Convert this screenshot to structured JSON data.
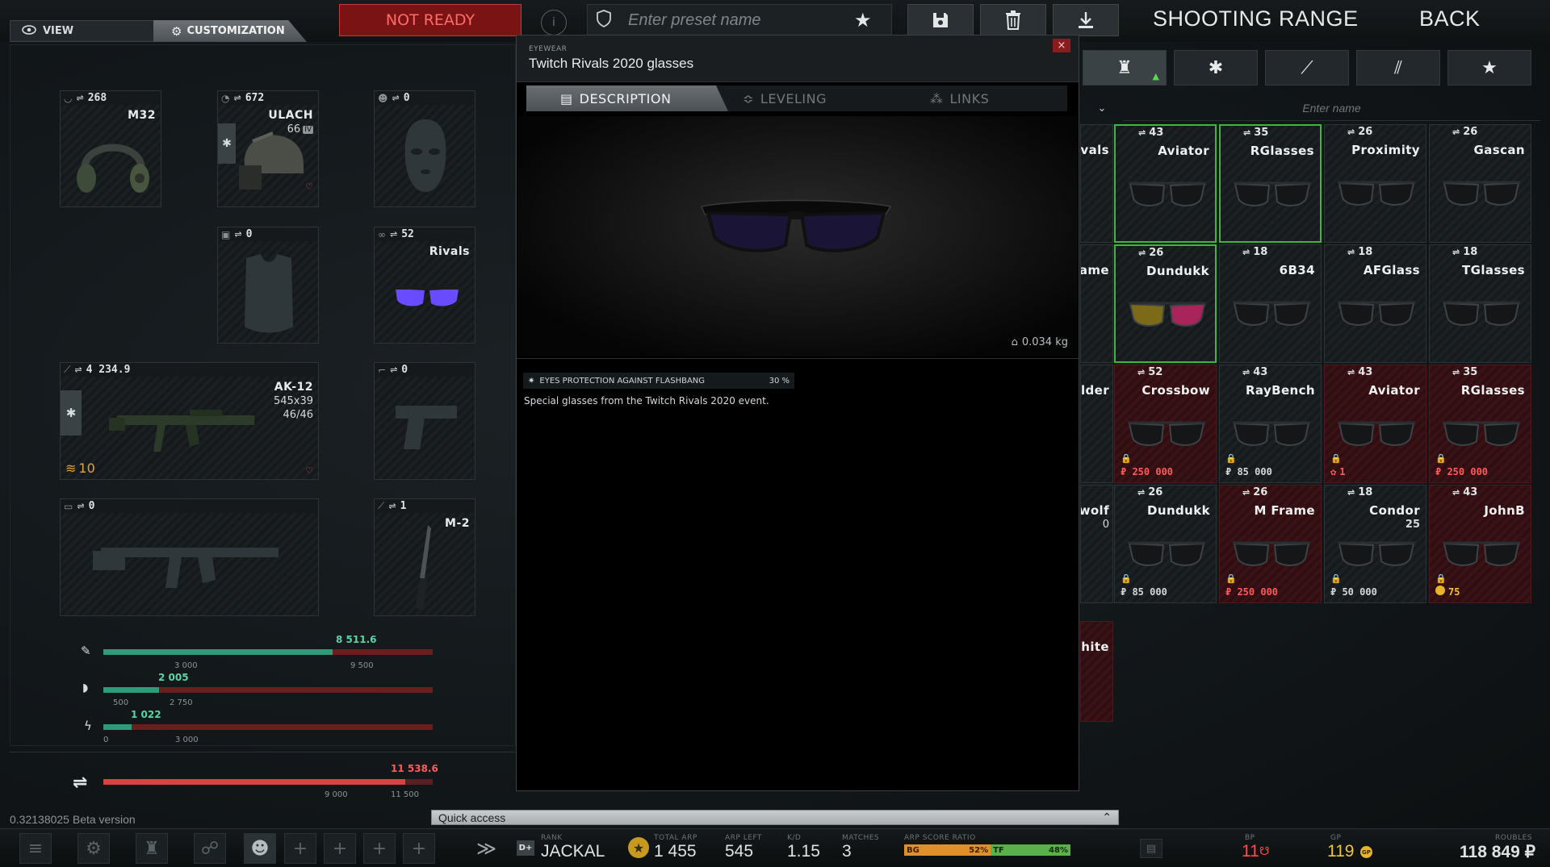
{
  "topbar": {
    "tab_view": "VIEW",
    "tab_customization": "CUSTOMIZATION",
    "not_ready": "NOT READY",
    "preset_placeholder": "Enter preset name",
    "shooting_range": "SHOOTING RANGE",
    "back": "BACK"
  },
  "loadout": {
    "headset": {
      "ap": "268",
      "name": "M32"
    },
    "helmet": {
      "ap": "672",
      "name": "ULACH",
      "durability": "66",
      "class": "IV"
    },
    "face": {
      "ap": "0"
    },
    "armor": {
      "ap": "0"
    },
    "eyewear": {
      "ap": "52",
      "name": "Rivals"
    },
    "primary": {
      "ap": "4 234.9",
      "name": "AK-12",
      "caliber": "545x39",
      "ammo": "46/46",
      "level": "10"
    },
    "holster": {
      "ap": "0"
    },
    "secondary": {
      "ap": "0"
    },
    "melee": {
      "ap": "1",
      "name": "M-2"
    }
  },
  "stats": [
    {
      "value": "8 511.6",
      "min": "3 000",
      "max": "9 500"
    },
    {
      "value": "2 005",
      "min": "500",
      "max": "2 750"
    },
    {
      "value": "1 022",
      "min": "0",
      "max": "3 000"
    }
  ],
  "total_ap": {
    "value": "11 538.6",
    "min": "9 000",
    "max": "11 500"
  },
  "version": "0.32138025 Beta version",
  "modal": {
    "category": "EYEWEAR",
    "title": "Twitch Rivals 2020 glasses",
    "tabs": [
      "DESCRIPTION",
      "LEVELING",
      "LINKS"
    ],
    "weight": "0.034 kg",
    "property_name": "EYES PROTECTION AGAINST FLASHBANG",
    "property_value": "30 %",
    "description": "Special glasses from the Twitch Rivals 2020 event."
  },
  "quick_access": "Quick access",
  "right": {
    "search_placeholder": "Enter name"
  },
  "cards_partial": [
    "vals",
    "ame",
    "lder",
    "wolf",
    "hite"
  ],
  "cards_partial_extra": "0",
  "cards": [
    {
      "ap": "43",
      "name": "Aviator",
      "style": "sel",
      "price": ""
    },
    {
      "ap": "35",
      "name": "RGlasses",
      "style": "sel",
      "price": ""
    },
    {
      "ap": "26",
      "name": "Proximity",
      "style": "",
      "price": ""
    },
    {
      "ap": "26",
      "name": "Gascan",
      "style": "",
      "price": ""
    },
    {
      "ap": "26",
      "name": "Dundukk",
      "style": "sel",
      "price": ""
    },
    {
      "ap": "18",
      "name": "6B34",
      "style": "",
      "price": ""
    },
    {
      "ap": "18",
      "name": "AFGlass",
      "style": "",
      "price": ""
    },
    {
      "ap": "18",
      "name": "TGlasses",
      "style": "",
      "price": ""
    },
    {
      "ap": "52",
      "name": "Crossbow",
      "style": "red",
      "price": "₽ 250 000"
    },
    {
      "ap": "43",
      "name": "RayBench",
      "style": "",
      "price": "₽ 85 000"
    },
    {
      "ap": "43",
      "name": "Aviator",
      "style": "red",
      "price": "1"
    },
    {
      "ap": "35",
      "name": "RGlasses",
      "style": "red",
      "price": "₽ 250 000"
    },
    {
      "ap": "26",
      "name": "Dundukk",
      "style": "",
      "price": "₽ 85 000"
    },
    {
      "ap": "26",
      "name": "M Frame",
      "style": "red",
      "price": "₽ 250 000"
    },
    {
      "ap": "18",
      "name": "Condor",
      "style": "",
      "price": "₽ 50 000",
      "extra": "25"
    },
    {
      "ap": "43",
      "name": "JohnB",
      "style": "red",
      "price": "75"
    }
  ],
  "bottom": {
    "rank_label": "RANK",
    "rank_badge": "D+",
    "player": "JACKAL",
    "total_arp_label": "TOTAL ARP",
    "total_arp": "1 455",
    "arp_left_label": "ARP LEFT",
    "arp_left": "545",
    "kd_label": "K/D",
    "kd": "1.15",
    "matches_label": "MATCHES",
    "matches": "3",
    "ratio_label": "ARP SCORE RATIO",
    "bg_label": "BG",
    "bg_pct": "52%",
    "tf_label": "TF",
    "tf_pct": "48%",
    "bp_label": "BP",
    "bp": "11",
    "gp_label": "GP",
    "gp": "119",
    "roubles_label": "ROUBLES",
    "roubles": "118 849 ₽"
  },
  "colors": {
    "accent_red": "#c43a3a",
    "green": "#44b33f",
    "stat_fill": "#2f9b78",
    "gold": "#e8b52a"
  }
}
